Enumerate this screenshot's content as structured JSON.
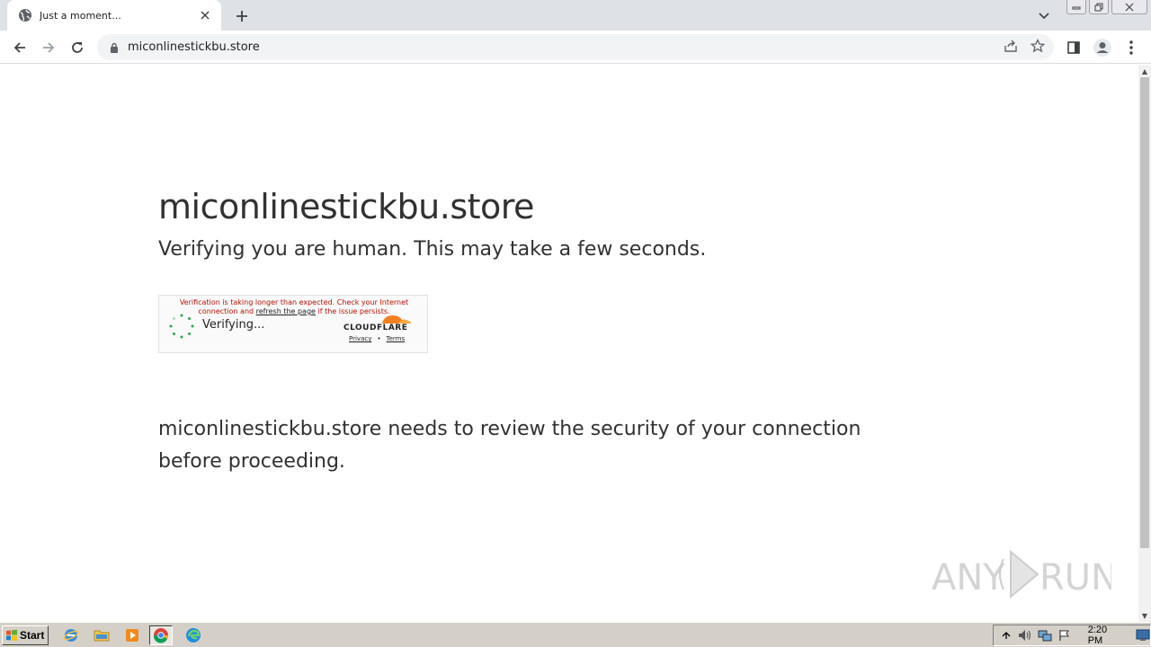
{
  "browser": {
    "tab_title": "Just a moment...",
    "url": "miconlinestickbu.store",
    "colors": {
      "tabstrip": "#dee1e6",
      "omnibox": "#f1f3f4"
    }
  },
  "page": {
    "heading": "miconlinestickbu.store",
    "subheading": "Verifying you are human. This may take a few seconds.",
    "widget": {
      "message_part1": "Verification is taking longer than expected. Check your Internet connection and",
      "message_link": "refresh the page",
      "message_part2": "if the issue persists.",
      "status": "Verifying...",
      "brand": "CLOUDFLARE",
      "privacy_link": "Privacy",
      "separator": "•",
      "terms_link": "Terms",
      "colors": {
        "message": "#b20f03",
        "brand_orange": "#f38020",
        "spinner": "#2ea44f"
      }
    },
    "paragraph": "miconlinestickbu.store needs to review the security of your connection before proceeding.",
    "watermark": "ANY RUN"
  },
  "taskbar": {
    "start_label": "Start",
    "clock": "2:20 PM",
    "icons": [
      "internet-explorer-icon",
      "folder-icon",
      "media-player-icon",
      "chrome-icon",
      "edge-icon"
    ]
  }
}
